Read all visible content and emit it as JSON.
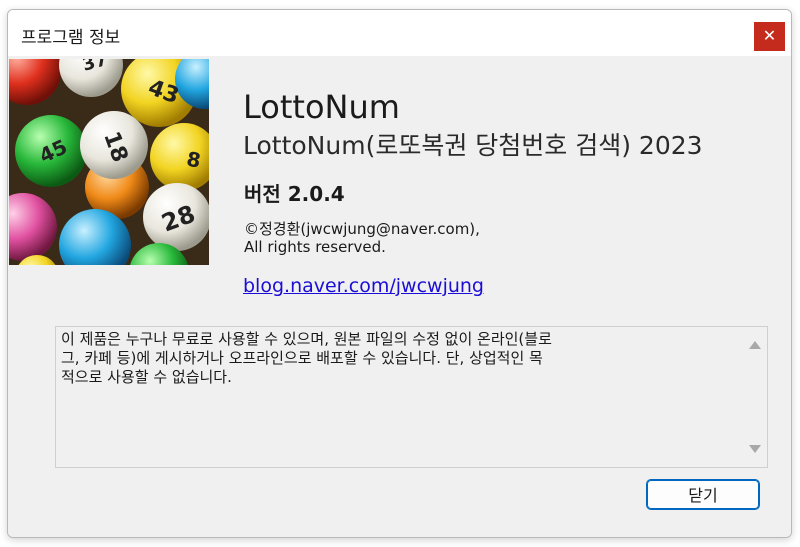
{
  "window": {
    "title": "프로그램 정보",
    "close_glyph": "✕"
  },
  "about": {
    "app_name": "LottoNum",
    "subtitle": "LottoNum(로또복권 당첨번호 검색) 2023",
    "version": "버전 2.0.4",
    "copyright_line1": "©정경환(jwcwjung@naver.com),",
    "copyright_line2": "All rights reserved.",
    "link": "blog.naver.com/jwcwjung"
  },
  "description": {
    "text": "이 제품은 누구나 무료로 사용할 수 있으며, 원본 파일의 수정 없이 온라인(블로\n그, 카페 등)에 게시하거나 오프라인으로 배포할 수 있습니다. 단, 상업적인 목\n적으로 사용할 수 없습니다."
  },
  "buttons": {
    "close_label": "닫기"
  },
  "image": {
    "icon": "lottery-balls-image",
    "ball_numbers": [
      "43",
      "37",
      "18",
      "45",
      "28",
      "8"
    ]
  },
  "colors": {
    "close_button": "#c42b1c",
    "link": "#1a0dd6",
    "focus_border": "#0067c0",
    "dialog_bg": "#f0f0f0"
  }
}
